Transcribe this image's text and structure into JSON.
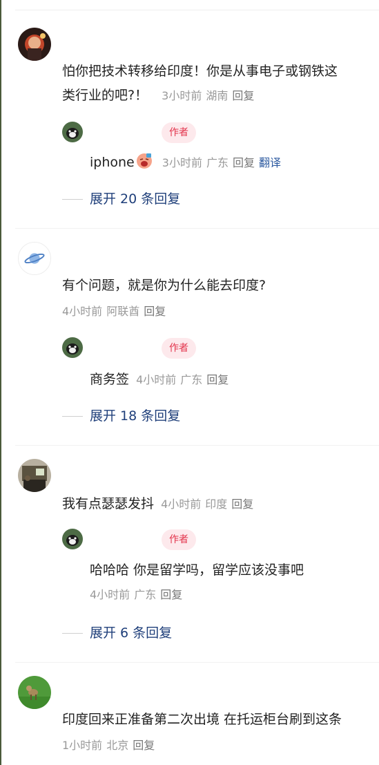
{
  "comments": [
    {
      "text_line1": "怕你把技术转移给印度！你是从事电子或钢铁这",
      "text_line2": "类行业的吧?！",
      "time": "3小时前",
      "location": "湖南",
      "reply": "回复",
      "author_reply": {
        "badge": "作者",
        "text": "iphone",
        "time": "3小时前",
        "location": "广东",
        "reply": "回复",
        "translate": "翻译"
      },
      "expand": "展开 20 条回复"
    },
    {
      "text": "有个问题，就是你为什么能去印度?",
      "time": "4小时前",
      "location": "阿联酋",
      "reply": "回复",
      "author_reply": {
        "badge": "作者",
        "text": "商务签",
        "time": "4小时前",
        "location": "广东",
        "reply": "回复"
      },
      "expand": "展开 18 条回复"
    },
    {
      "text": "我有点瑟瑟发抖",
      "time": "4小时前",
      "location": "印度",
      "reply": "回复",
      "author_reply": {
        "badge": "作者",
        "text": "哈哈哈 你是留学吗，留学应该没事吧",
        "time": "4小时前",
        "location": "广东",
        "reply": "回复"
      },
      "expand": "展开 6 条回复"
    },
    {
      "text": "印度回来正准备第二次出境 在托运柜台刷到这条",
      "time": "1小时前",
      "location": "北京",
      "reply": "回复"
    }
  ],
  "colors": {
    "badge_bg": "#fde9ec",
    "badge_text": "#e3344c",
    "expand_text": "#1f3f7a",
    "translate": "#2c5aa0"
  },
  "icons": {
    "emoji_after_iphone": "crying-face-emoji"
  }
}
